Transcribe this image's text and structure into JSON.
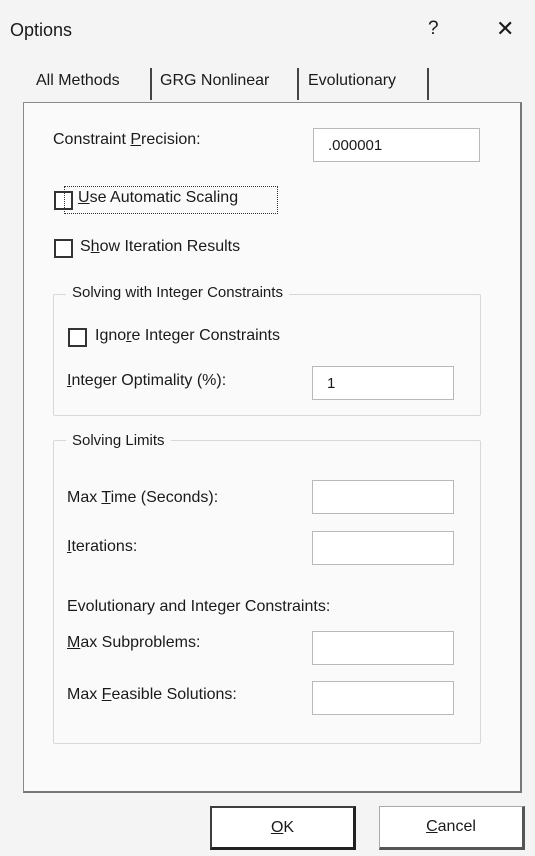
{
  "window": {
    "title": "Options",
    "help_glyph": "?",
    "close_glyph": "✕"
  },
  "tabs": [
    {
      "label": "All Methods",
      "active": true
    },
    {
      "label": "GRG Nonlinear",
      "active": false
    },
    {
      "label": "Evolutionary",
      "active": false
    }
  ],
  "constraint_precision": {
    "label_pre": "Constraint ",
    "label_u": "P",
    "label_post": "recision:",
    "value": ".000001"
  },
  "checkboxes": {
    "automatic_scaling": {
      "label_u": "U",
      "label_post": "se Automatic Scaling",
      "checked": false
    },
    "iteration_results": {
      "label_pre": "S",
      "label_u": "h",
      "label_post": "ow Iteration Results",
      "checked": false
    },
    "ignore_integer": {
      "label_pre": "Igno",
      "label_u": "r",
      "label_post": "e Integer Constraints",
      "checked": false
    }
  },
  "integer_group": {
    "title": "Solving with Integer Constraints",
    "optimality": {
      "label_u": "I",
      "label_post": "nteger Optimality (%):",
      "value": "1"
    }
  },
  "limits_group": {
    "title": "Solving Limits",
    "max_time": {
      "label_pre": "Max ",
      "label_u": "T",
      "label_post": "ime (Seconds):",
      "value": ""
    },
    "iterations": {
      "label_u": "I",
      "label_post": "terations:",
      "value": ""
    },
    "evo_heading": "Evolutionary and Integer Constraints:",
    "max_subproblems": {
      "label_u": "M",
      "label_post": "ax Subproblems:",
      "value": ""
    },
    "max_feasible": {
      "label_pre": "Max ",
      "label_u": "F",
      "label_post": "easible Solutions:",
      "value": ""
    }
  },
  "buttons": {
    "ok": {
      "label_u": "O",
      "label_post": "K"
    },
    "cancel": {
      "label_u": "C",
      "label_post": "ancel"
    }
  }
}
